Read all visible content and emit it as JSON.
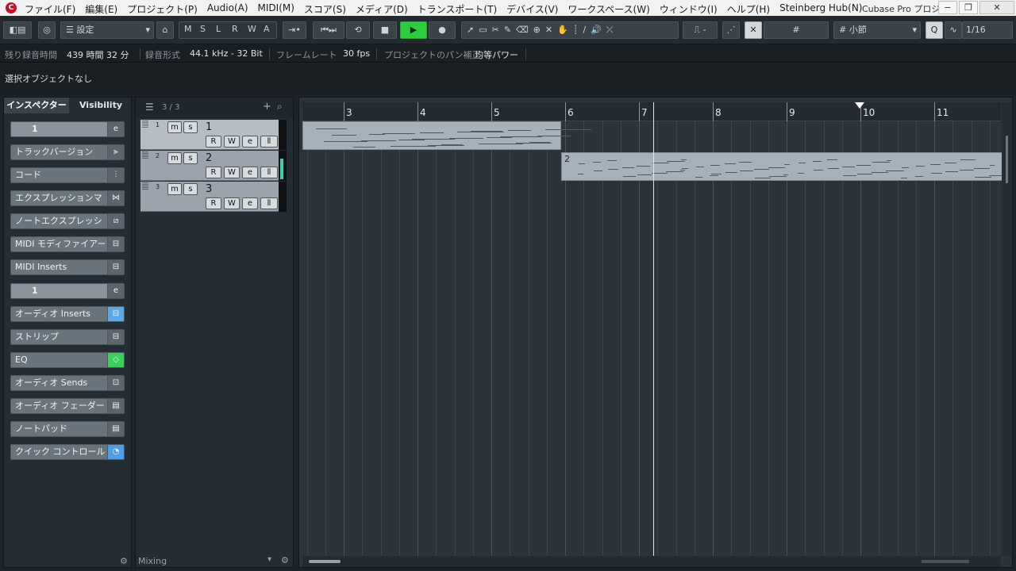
{
  "menubar": {
    "app_logo": "cubase-logo",
    "items": [
      "ファイル(F)",
      "編集(E)",
      "プロジェクト(P)",
      "Audio(A)",
      "MIDI(M)",
      "スコア(S)",
      "メディア(D)",
      "トランスポート(T)",
      "デバイス(V)",
      "ワークスペース(W)",
      "ウィンドウ(I)",
      "ヘルプ(H)",
      "Steinberg Hub(N)"
    ],
    "window_title": "Cubase Pro プロジ…"
  },
  "toolbar": {
    "setting_label": "設定",
    "mode_letters": [
      "M",
      "S",
      "L",
      "R",
      "W",
      "A"
    ],
    "snap_label": "小節",
    "quantize_label": "1/16"
  },
  "infobar": {
    "rec_time_label": "残り録音時間",
    "rec_time_value": "439 時間 32 分",
    "rec_format_label": "録音形式",
    "rec_format_value": "44.1 kHz - 32 Bit",
    "framerate_label": "フレームレート",
    "framerate_value": "30 fps",
    "pan_label": "プロジェクトのパン補正",
    "pan_value": "均等パワー"
  },
  "selection": {
    "status": "選択オブジェクトなし"
  },
  "inspector": {
    "tab_inspector": "インスペクター",
    "tab_visibility": "Visibility",
    "track_name": "1",
    "sections": [
      "トラックバージョン",
      "コード",
      "エクスプレッションマ",
      "ノートエクスプレッシ",
      "MIDI モディファイアー",
      "MIDI Inserts"
    ],
    "channel_name": "1",
    "channel_sections": [
      "オーディオ Inserts",
      "ストリップ",
      "EQ",
      "オーディオ Sends",
      "オーディオ フェーダー",
      "ノートパッド",
      "クイック コントロール"
    ]
  },
  "tracklist": {
    "count": "3 / 3",
    "footer": "Mixing",
    "tracks": [
      {
        "num": "1",
        "name": "1"
      },
      {
        "num": "2",
        "name": "2"
      },
      {
        "num": "3",
        "name": "3"
      }
    ]
  },
  "ruler": {
    "bars": [
      "3",
      "4",
      "5",
      "6",
      "7",
      "8",
      "9",
      "10",
      "11"
    ]
  },
  "parts": [
    {
      "track": "1",
      "label": ""
    },
    {
      "track": "2",
      "label": "2"
    }
  ]
}
